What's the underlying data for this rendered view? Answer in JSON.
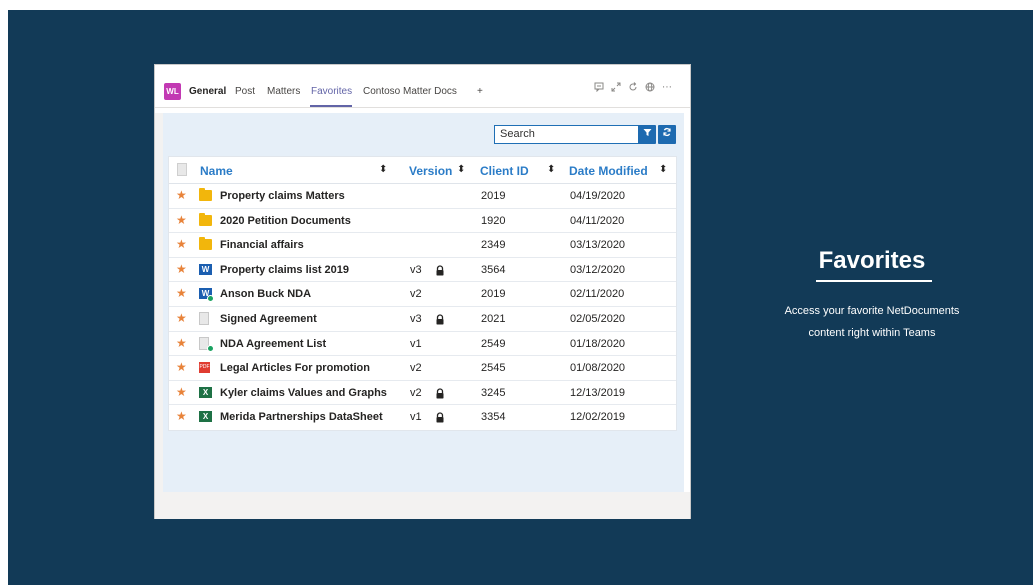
{
  "team": {
    "avatar_initials": "WL",
    "avatar_color": "#c239b3"
  },
  "tabs": [
    {
      "label": "General",
      "bold": true
    },
    {
      "label": "Post"
    },
    {
      "label": "Matters"
    },
    {
      "label": "Favorites",
      "active": true
    },
    {
      "label": "Contoso Matter Docs"
    },
    {
      "label": "+"
    }
  ],
  "window_icons": [
    "chat-icon",
    "expand-icon",
    "refresh-icon",
    "globe-icon",
    "more-icon"
  ],
  "search": {
    "value": "Search"
  },
  "table": {
    "columns": [
      "Name",
      "Version",
      "Client ID",
      "Date Modified"
    ],
    "rows": [
      {
        "icon": "folder-icon",
        "name": "Property claims Matters",
        "version": "",
        "locked": false,
        "client_id": "2019",
        "date": "04/19/2020"
      },
      {
        "icon": "folder-icon",
        "name": "2020 Petition Documents",
        "version": "",
        "locked": false,
        "client_id": "1920",
        "date": "04/11/2020"
      },
      {
        "icon": "folder-icon",
        "name": "Financial affairs",
        "version": "",
        "locked": false,
        "client_id": "2349",
        "date": "03/13/2020"
      },
      {
        "icon": "word-icon",
        "name": "Property claims list 2019",
        "version": "v3",
        "locked": true,
        "client_id": "3564",
        "date": "03/12/2020"
      },
      {
        "icon": "word-icon",
        "name": "Anson Buck NDA",
        "version": "v2",
        "locked": false,
        "checked": true,
        "client_id": "2019",
        "date": "02/11/2020"
      },
      {
        "icon": "document-icon",
        "name": "Signed Agreement",
        "version": "v3",
        "locked": true,
        "client_id": "2021",
        "date": "02/05/2020"
      },
      {
        "icon": "document-icon",
        "name": "NDA Agreement List",
        "version": "v1",
        "locked": false,
        "checked": true,
        "client_id": "2549",
        "date": "01/18/2020"
      },
      {
        "icon": "pdf-icon",
        "name": "Legal Articles For promotion",
        "version": "v2",
        "locked": false,
        "client_id": "2545",
        "date": "01/08/2020"
      },
      {
        "icon": "excel-icon",
        "name": "Kyler claims Values and Graphs",
        "version": "v2",
        "locked": true,
        "client_id": "3245",
        "date": "12/13/2019"
      },
      {
        "icon": "excel-icon",
        "name": "Merida Partnerships DataSheet",
        "version": "v1",
        "locked": true,
        "client_id": "3354",
        "date": "12/02/2019"
      }
    ]
  },
  "promo": {
    "title": "Favorites",
    "description_line1": "Access your favorite NetDocuments",
    "description_line2": "content right within Teams"
  },
  "colors": {
    "background": "#123a57",
    "accent": "#2b7cc7",
    "star": "#e8833a",
    "teams_purple": "#6264a7"
  }
}
